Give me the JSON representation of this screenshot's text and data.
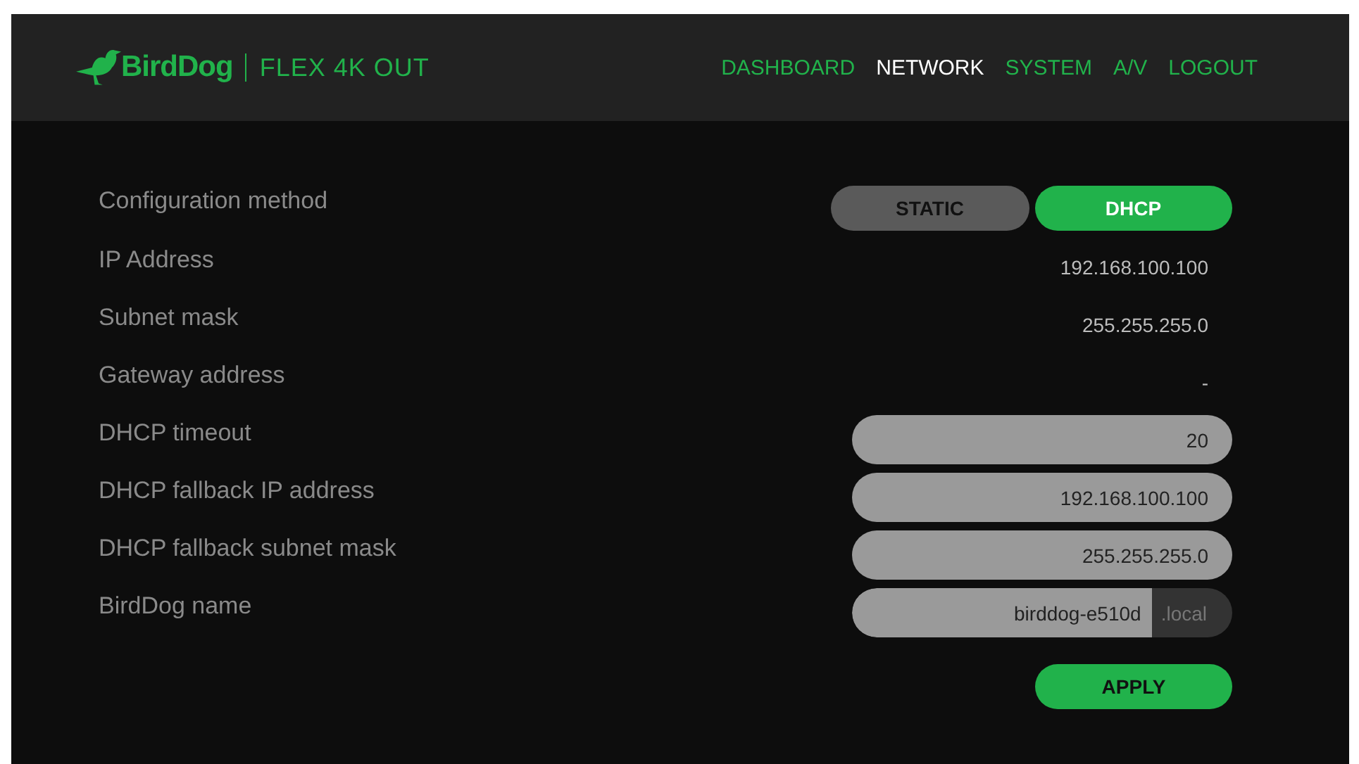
{
  "brand": {
    "logo": "BirdDog",
    "product": "FLEX 4K OUT"
  },
  "nav": [
    {
      "label": "DASHBOARD",
      "selected": false
    },
    {
      "label": "NETWORK",
      "selected": true
    },
    {
      "label": "SYSTEM",
      "selected": false
    },
    {
      "label": "A/V",
      "selected": false
    },
    {
      "label": "LOGOUT",
      "selected": false
    }
  ],
  "rows": [
    {
      "kind": "toggle",
      "label": "Configuration method",
      "options": [
        {
          "label": "STATIC",
          "selected": false
        },
        {
          "label": "DHCP",
          "selected": true
        }
      ]
    },
    {
      "kind": "text",
      "label": "IP Address",
      "value": "192.168.100.100"
    },
    {
      "kind": "text",
      "label": "Subnet mask",
      "value": "255.255.255.0"
    },
    {
      "kind": "text",
      "label": "Gateway address",
      "value": "-"
    },
    {
      "kind": "input",
      "label": "DHCP timeout",
      "value": "20"
    },
    {
      "kind": "input",
      "label": "DHCP fallback IP address",
      "value": "192.168.100.100"
    },
    {
      "kind": "input",
      "label": "DHCP fallback subnet mask",
      "value": "255.255.255.0"
    },
    {
      "kind": "input-suffix",
      "label": "BirdDog name",
      "value": "birddog-e510d",
      "suffix": ".local"
    }
  ],
  "apply_button": "APPLY"
}
